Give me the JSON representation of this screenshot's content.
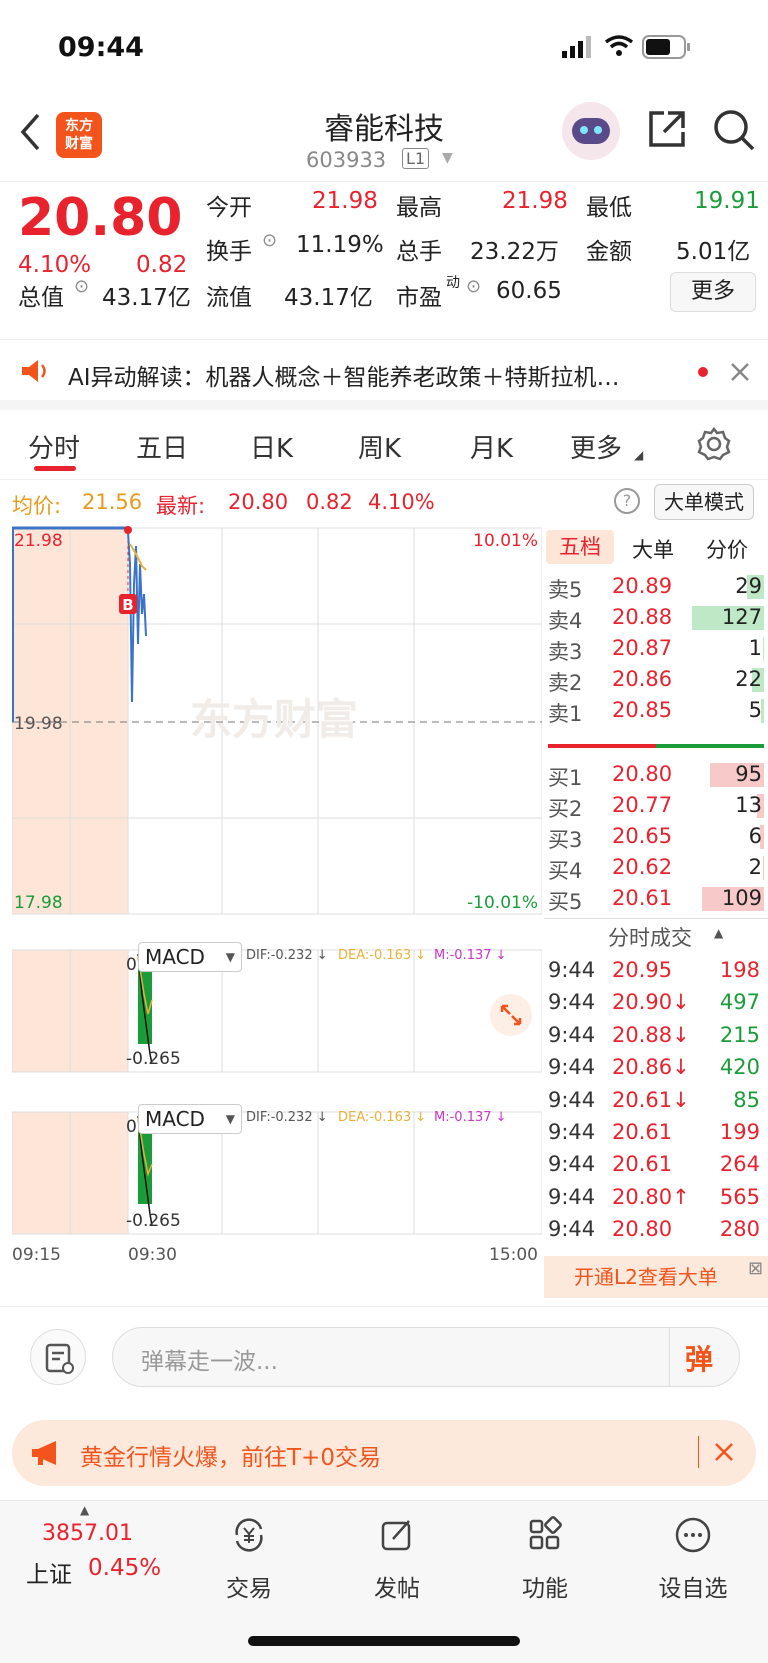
{
  "status": {
    "time": "09:44"
  },
  "header": {
    "logo_text": "东方财富",
    "title": "睿能科技",
    "code": "603933",
    "level": "L1"
  },
  "quote": {
    "price": "20.80",
    "change_pct": "4.10%",
    "change": "0.82",
    "open_label": "今开",
    "open": "21.98",
    "high_label": "最高",
    "high": "21.98",
    "low_label": "最低",
    "low": "19.91",
    "turnover_label": "换手",
    "turnover": "11.19%",
    "volume_label": "总手",
    "volume": "23.22万",
    "amount_label": "金额",
    "amount": "5.01亿",
    "mcap_label": "总值",
    "mcap": "43.17亿",
    "float_label": "流值",
    "float": "43.17亿",
    "pe_label": "市盈",
    "pe_sup": "动",
    "pe": "60.65",
    "more": "更多"
  },
  "ai": {
    "text": "AI异动解读：机器人概念＋智能养老政策＋特斯拉机…"
  },
  "tabs": [
    "分时",
    "五日",
    "日K",
    "周K",
    "月K",
    "更多"
  ],
  "info": {
    "avg_label": "均价:",
    "avg": "21.56",
    "latest_label": "最新:",
    "latest": "20.80",
    "chg": "0.82",
    "pct": "4.10%",
    "mode": "大单模式"
  },
  "chart": {
    "y_max": "21.98",
    "y_mid": "19.98",
    "y_min": "17.98",
    "pct_max": "10.01%",
    "pct_min": "-10.01%",
    "watermark": "东方财富",
    "b_marker": "B",
    "macd_label": "MACD",
    "dif": "DIF:-0.232 ↓",
    "dea": "DEA:-0.163 ↓",
    "m": "M:-0.137 ↓",
    "macd_top": "0.000",
    "macd_bottom": "-0.265",
    "t_start": "09:15",
    "t_open": "09:30",
    "t_end": "15:00"
  },
  "orderbook": {
    "tabs": [
      "五档",
      "大单",
      "分价"
    ],
    "asks": [
      {
        "label": "卖5",
        "price": "20.89",
        "vol": "29",
        "bar": 0.23
      },
      {
        "label": "卖4",
        "price": "20.88",
        "vol": "127",
        "bar": 1.0
      },
      {
        "label": "卖3",
        "price": "20.87",
        "vol": "1",
        "bar": 0.01
      },
      {
        "label": "卖2",
        "price": "20.86",
        "vol": "22",
        "bar": 0.17
      },
      {
        "label": "卖1",
        "price": "20.85",
        "vol": "5",
        "bar": 0.04
      }
    ],
    "bids": [
      {
        "label": "买1",
        "price": "20.80",
        "vol": "95",
        "bar": 0.75
      },
      {
        "label": "买2",
        "price": "20.77",
        "vol": "13",
        "bar": 0.1
      },
      {
        "label": "买3",
        "price": "20.65",
        "vol": "6",
        "bar": 0.05
      },
      {
        "label": "买4",
        "price": "20.62",
        "vol": "2",
        "bar": 0.02
      },
      {
        "label": "买5",
        "price": "20.61",
        "vol": "109",
        "bar": 0.86
      }
    ],
    "ticks_title": "分时成交",
    "ticks": [
      {
        "t": "9:44",
        "p": "20.95",
        "v": "198"
      },
      {
        "t": "9:44",
        "p": "20.90↓",
        "v": "497"
      },
      {
        "t": "9:44",
        "p": "20.88↓",
        "v": "215"
      },
      {
        "t": "9:44",
        "p": "20.86↓",
        "v": "420"
      },
      {
        "t": "9:44",
        "p": "20.61↓",
        "v": "85"
      },
      {
        "t": "9:44",
        "p": "20.61",
        "v": "199"
      },
      {
        "t": "9:44",
        "p": "20.61",
        "v": "264"
      },
      {
        "t": "9:44",
        "p": "20.80↑",
        "v": "565"
      },
      {
        "t": "9:44",
        "p": "20.80",
        "v": "280"
      }
    ],
    "l2": "开通L2查看大单"
  },
  "bullet": {
    "placeholder": "弹幕走一波...",
    "btn": "弹"
  },
  "gold": {
    "text": "黄金行情火爆，前往T+0交易"
  },
  "nav": {
    "index_value": "3857.01",
    "index_name": "上证",
    "index_pct": "0.45%",
    "trade": "交易",
    "post": "发帖",
    "func": "功能",
    "watch": "设自选"
  }
}
